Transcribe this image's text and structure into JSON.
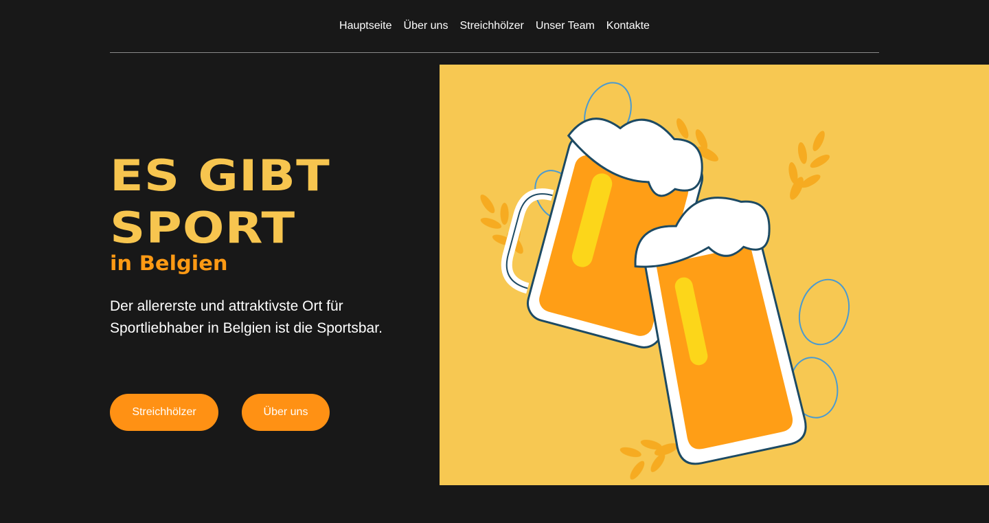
{
  "nav": {
    "items": [
      {
        "label": "Hauptseite"
      },
      {
        "label": "Über uns"
      },
      {
        "label": "Streichhölzer"
      },
      {
        "label": "Unser Team"
      },
      {
        "label": "Kontakte"
      }
    ]
  },
  "hero": {
    "title_line1": "ES GIBT",
    "title_line2": "SPORT",
    "subtitle": "in Belgien",
    "description": "Der allererste und attraktivste Ort für Sportliebhaber in Belgien ist die Sportsbar.",
    "button_primary": "Streichhölzer",
    "button_secondary": "Über uns"
  },
  "colors": {
    "background": "#181818",
    "title": "#f7c54f",
    "accent": "#ff9114",
    "illustration_bg": "#f7c852"
  },
  "illustration": {
    "icon": "beer-toast-illustration"
  }
}
